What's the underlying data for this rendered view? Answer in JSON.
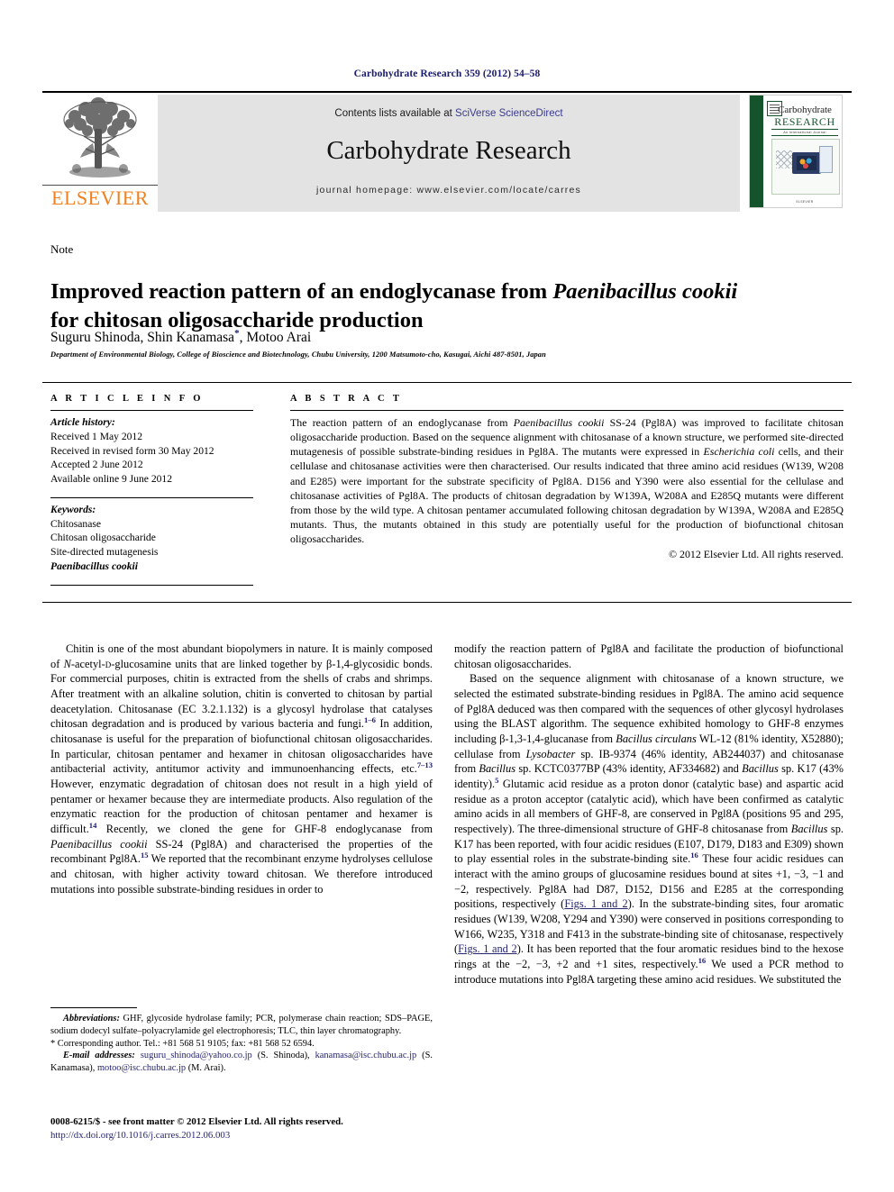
{
  "running_head": "Carbohydrate Research 359 (2012) 54–58",
  "masthead": {
    "contents_prefix": "Contents lists available at ",
    "contents_link": "SciVerse ScienceDirect",
    "journal_title": "Carbohydrate Research",
    "homepage": "journal homepage: www.elsevier.com/locate/carres",
    "publisher_wordmark": "ELSEVIER",
    "cover": {
      "line1": "Carbohydrate",
      "line2": "RESEARCH",
      "line3": "An International Journal",
      "footer": "ELSEVIER"
    }
  },
  "article": {
    "type_label": "Note",
    "title_part1": "Improved reaction pattern of an endoglycanase from ",
    "title_italic": "Paenibacillus cookii",
    "title_part2": "for chitosan oligosaccharide production",
    "authors": "Suguru Shinoda, Shin Kanamasa",
    "authors_mark": "*",
    "authors_rest": ", Motoo Arai",
    "affiliation": "Department of Environmental Biology, College of Bioscience and Biotechnology, Chubu University, 1200 Matsumoto-cho, Kasugai, Aichi 487-8501, Japan"
  },
  "article_info": {
    "heading": "A R T I C L E   I N F O",
    "history_label": "Article history:",
    "history": [
      "Received 1 May 2012",
      "Received in revised form 30 May 2012",
      "Accepted 2 June 2012",
      "Available online 9 June 2012"
    ],
    "keywords_label": "Keywords:",
    "keywords": [
      "Chitosanase",
      "Chitosan oligosaccharide",
      "Site-directed mutagenesis"
    ],
    "keyword_italic": "Paenibacillus cookii"
  },
  "abstract": {
    "heading": "A B S T R A C T",
    "p1a": "The reaction pattern of an endoglycanase from ",
    "p1_it1": "Paenibacillus cookii",
    "p1b": " SS-24 (Pgl8A) was improved to facilitate chitosan oligosaccharide production. Based on the sequence alignment with chitosanase of a known structure, we performed site-directed mutagenesis of possible substrate-binding residues in Pgl8A. The mutants were expressed in ",
    "p1_it2": "Escherichia coli",
    "p1c": " cells, and their cellulase and chitosanase activities were then characterised. Our results indicated that three amino acid residues (W139, W208 and E285) were important for the substrate specificity of Pgl8A. D156 and Y390 were also essential for the cellulase and chitosanase activities of Pgl8A. The products of chitosan degradation by W139A, W208A and E285Q mutants were different from those by the wild type. A chitosan pentamer accumulated following chitosan degradation by W139A, W208A and E285Q mutants. Thus, the mutants obtained in this study are potentially useful for the production of biofunctional chitosan oligosaccharides.",
    "copyright": "© 2012 Elsevier Ltd. All rights reserved."
  },
  "body": {
    "left": {
      "p1_a": "Chitin is one of the most abundant biopolymers in nature. It is mainly composed of ",
      "p1_it1": "N",
      "p1_b": "-acetyl-",
      "p1_sc": "d",
      "p1_c": "-glucosamine units that are linked together by β-1,4-glycosidic bonds. For commercial purposes, chitin is extracted from the shells of crabs and shrimps. After treatment with an alkaline solution, chitin is converted to chitosan by partial deacetylation. Chitosanase (EC 3.2.1.132) is a glycosyl hydrolase that catalyses chitosan degradation and is produced by various bacteria and fungi.",
      "ref1": "1–6",
      "p1_d": " In addition, chitosanase is useful for the preparation of biofunctional chitosan oligosaccharides. In particular, chitosan pentamer and hexamer in chitosan oligosaccharides have antibacterial activity, antitumor activity and immunoenhancing effects, etc.",
      "ref2": "7–13",
      "p1_e": " However, enzymatic degradation of chitosan does not result in a high yield of pentamer or hexamer because they are intermediate products. Also regulation of the enzymatic reaction for the production of chitosan pentamer and hexamer is difficult.",
      "ref3": "14",
      "p1_f": " Recently, we cloned the gene for GHF-8 endoglycanase from ",
      "p1_it2": "Paenibacillus cookii",
      "p1_g": " SS-24 (Pgl8A) and characterised the properties of the recombinant Pgl8A.",
      "ref4": "15",
      "p1_h": " We reported that the recombinant enzyme hydrolyses cellulose and chitosan, with higher activity toward chitosan. We therefore introduced mutations into possible substrate-binding residues in order to"
    },
    "right": {
      "p1": "modify the reaction pattern of Pgl8A and facilitate the production of biofunctional chitosan oligosaccharides.",
      "p2_a": "Based on the sequence alignment with chitosanase of a known structure, we selected the estimated substrate-binding residues in Pgl8A. The amino acid sequence of Pgl8A deduced was then compared with the sequences of other glycosyl hydrolases using the BLAST algorithm. The sequence exhibited homology to GHF-8 enzymes including β-1,3-1,4-glucanase from ",
      "p2_it1": "Bacillus circulans",
      "p2_b": " WL-12 (81% identity, X52880); cellulase from ",
      "p2_it2": "Lysobacter",
      "p2_c": " sp. IB-9374 (46% identity, AB244037) and chitosanase from ",
      "p2_it3": "Bacillus",
      "p2_d": " sp. KCTC0377BP (43% identity, AF334682) and ",
      "p2_it4": "Bacillus",
      "p2_e": " sp. K17 (43% identity).",
      "ref5": "5",
      "p2_f": " Glutamic acid residue as a proton donor (catalytic base) and aspartic acid residue as a proton acceptor (catalytic acid), which have been confirmed as catalytic amino acids in all members of GHF-8, are conserved in Pgl8A (positions 95 and 295, respectively). The three-dimensional structure of GHF-8 chitosanase from ",
      "p2_it5": "Bacillus",
      "p2_g": " sp. K17 has been reported, with four acidic residues (E107, D179, D183 and E309) shown to play essential roles in the substrate-binding site.",
      "ref16a": "16",
      "p2_h": " These four acidic residues can interact with the amino groups of glucosamine residues bound at sites +1, −3, −1 and −2, respectively. Pgl8A had D87, D152, D156 and E285 at the corresponding positions, respectively (",
      "figlink1": "Figs. 1 and 2",
      "p2_i": "). In the substrate-binding sites, four aromatic residues (W139, W208, Y294 and Y390) were conserved in positions corresponding to W166, W235, Y318 and F413 in the substrate-binding site of chitosanase, respectively (",
      "figlink2": "Figs. 1 and 2",
      "p2_j": "). It has been reported that the four aromatic residues bind to the hexose rings at the −2, −3, +2 and +1 sites, respectively.",
      "ref16b": "16",
      "p2_k": " We used a PCR method to introduce mutations into Pgl8A targeting these amino acid residues. We substituted the"
    }
  },
  "footnotes": {
    "abbr_label": "Abbreviations:",
    "abbr_text": " GHF, glycoside hydrolase family; PCR, polymerase chain reaction; SDS–PAGE, sodium dodecyl sulfate–polyacrylamide gel electrophoresis; TLC, thin layer chromatography.",
    "corresponding": "* Corresponding author. Tel.: +81 568 51 9105; fax: +81 568 52 6594.",
    "email_label": "E-mail addresses:",
    "email1": "suguru_shinoda@yahoo.co.jp",
    "email1_who": " (S. Shinoda), ",
    "email2": "kanamasa@isc.chubu.ac.jp",
    "email2_who": " (S. Kanamasa), ",
    "email3": "motoo@isc.chubu.ac.jp",
    "email3_who": " (M. Arai)."
  },
  "issn": {
    "line1": "0008-6215/$ - see front matter © 2012 Elsevier Ltd. All rights reserved.",
    "doi": "http://dx.doi.org/10.1016/j.carres.2012.06.003"
  },
  "colors": {
    "link_blue": "#3a3a8e",
    "ref_blue": "#1a1a6e",
    "elsevier_orange": "#f08020",
    "cover_green": "#14532b",
    "panel_grey": "#e3e3e3"
  }
}
